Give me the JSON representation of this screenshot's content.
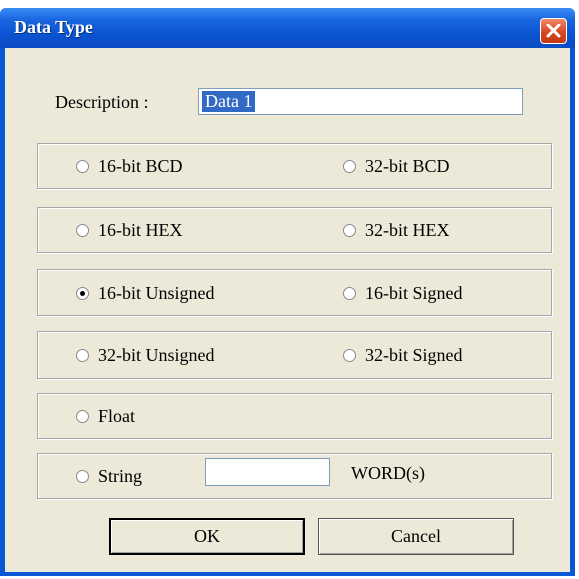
{
  "window": {
    "title": "Data Type"
  },
  "description": {
    "label": "Description :",
    "value": "Data 1"
  },
  "options": [
    {
      "left": "16-bit BCD",
      "right": "32-bit BCD"
    },
    {
      "left": "16-bit HEX",
      "right": "32-bit HEX"
    },
    {
      "left": "16-bit Unsigned",
      "right": "16-bit Signed"
    },
    {
      "left": "32-bit Unsigned",
      "right": "32-bit Signed"
    },
    {
      "left": "Float"
    },
    {
      "left": "String"
    }
  ],
  "selected": "16-bit Unsigned",
  "string": {
    "value": "",
    "unit_label": "WORD(s)"
  },
  "buttons": {
    "ok": "OK",
    "cancel": "Cancel"
  },
  "colors": {
    "titlebar": "#0a57d6",
    "face": "#ece9d8",
    "close": "#d9471f"
  }
}
